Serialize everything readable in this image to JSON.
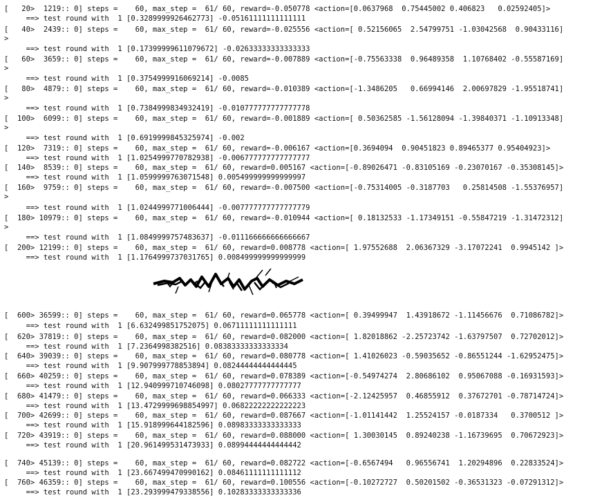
{
  "lines": [
    "[   20>  1219:: 0] steps =    60, max_step =  61/ 60, reward=-0.050778 <action=[0.0637968  0.75445002 0.406823   0.02592405]>",
    "     ==> test round with  1 [0.3289999926462773] -0.05161111111111111",
    "[   40>  2439:: 0] steps =    60, max_step =  61/ 60, reward=-0.025556 <action=[ 0.52156065  2.54799751 -1.03042568  0.90433116]",
    ">",
    "     ==> test round with  1 [0.17399999611079672] -0.02633333333333333",
    "[   60>  3659:: 0] steps =    60, max_step =  61/ 60, reward=-0.007889 <action=[-0.75563338  0.96489358  1.10768402 -0.55587169]",
    ">",
    "     ==> test round with  1 [0.3754999916069214] -0.0085",
    "[   80>  4879:: 0] steps =    60, max_step =  61/ 60, reward=-0.010389 <action=[-1.3486205   0.66994146  2.00697829 -1.95518741]",
    ">",
    "     ==> test round with  1 [0.7384999834932419] -0.010777777777777778",
    "[  100>  6099:: 0] steps =    60, max_step =  61/ 60, reward=-0.001889 <action=[ 0.50362585 -1.56128094 -1.39840371 -1.10913348]",
    ">",
    "     ==> test round with  1 [0.6919999845325974] -0.002",
    "[  120>  7319:: 0] steps =    60, max_step =  61/ 60, reward=-0.006167 <action=[0.3694094  0.90451823 0.89465377 0.95404923]>",
    "     ==> test round with  1 [1.0254999770782938] -0.006777777777777777",
    "[  140>  8539:: 0] steps =    60, max_step =  61/ 60, reward=0.005167 <action=[-0.89026471 -0.83105169 -0.23070167 -0.35308145]>",
    "     ==> test round with  1 [1.0599999763071548] 0.005499999999999997",
    "[  160>  9759:: 0] steps =    60, max_step =  61/ 60, reward=-0.007500 <action=[-0.75314005 -0.3187703   0.25814508 -1.55376957]",
    ">",
    "     ==> test round with  1 [1.0244999771006444] -0.007777777777777779",
    "[  180> 10979:: 0] steps =    60, max_step =  61/ 60, reward=-0.010944 <action=[ 0.18132533 -1.17349151 -0.55847219 -1.31472312]",
    ">",
    "     ==> test round with  1 [1.0849999757483637] -0.011166666666666667",
    "[  200> 12199:: 0] steps =    60, max_step =  61/ 60, reward=0.008778 <action=[ 1.97552688  2.06367329 -3.17072241  0.9945142 ]>",
    "     ==> test round with  1 [1.1764999737031765] 0.008499999999999999",
    "[  600> 36599:: 0] steps =    60, max_step =  61/ 60, reward=0.065778 <action=[ 0.39499947  1.43918672 -1.11456676  0.71086782]>",
    "     ==> test round with  1 [6.632499851752075] 0.06711111111111111",
    "[  620> 37819:: 0] steps =    60, max_step =  61/ 60, reward=0.082000 <action=[ 1.82018862 -2.25723742 -1.63797507  0.72702012]>",
    "     ==> test round with  1 [7.2364998382516] 0.08383333333333334",
    "[  640> 39039:: 0] steps =    60, max_step =  61/ 60, reward=0.080778 <action=[ 1.41026023 -0.59035652 -0.86551244 -1.62952475]>",
    "     ==> test round with  1 [9.907999778853894] 0.08244444444444445",
    "[  660> 40259:: 0] steps =    60, max_step =  61/ 60, reward=0.078389 <action=[-0.54974274  2.80686102  0.95067088 -0.16931593]>",
    "     ==> test round with  1 [12.940999710746098] 0.08027777777777777",
    "[  680> 41479:: 0] steps =    60, max_step =  61/ 60, reward=0.066333 <action=[-2.12425957  0.46855912  0.37672701 -0.78714724]>",
    "     ==> test round with  1 [13.4729999698854997] 0.06822222222222223",
    "[  700> 42699:: 0] steps =    60, max_step =  61/ 60, reward=0.087667 <action=[-1.01141442  1.25524157 -0.0187334   0.3700512 ]>",
    "     ==> test round with  1 [15.918999644182596] 0.08983333333333333",
    "[  720> 43919:: 0] steps =    60, max_step =  61/ 60, reward=0.088000 <action=[ 1.30030145  0.89240238 -1.16739695  0.70672923]>",
    "     ==> test round with  1 [20.961499531473933] 0.08994444444444442",
    "[  740> 45139:: 0] steps =    60, max_step =  61/ 60, reward=0.082722 <action=[-0.6567494   0.96556741  1.20294896  0.22833524]>",
    "     ==> test round with  1 [23.667499470990162] 0.08461111111111112",
    "[  760> 46359:: 0] steps =    60, max_step =  61/ 60, reward=0.100556 <action=[-0.10272727  0.50201502 -0.36531323 -0.07291312]>",
    "     ==> test round with  1 [23.293999479338556] 0.10283333333333336"
  ],
  "colors": {
    "text": "#111111",
    "background": "#ffffff",
    "tear": "#000000"
  },
  "icons": {
    "break": "torn-paper-gap-icon"
  }
}
